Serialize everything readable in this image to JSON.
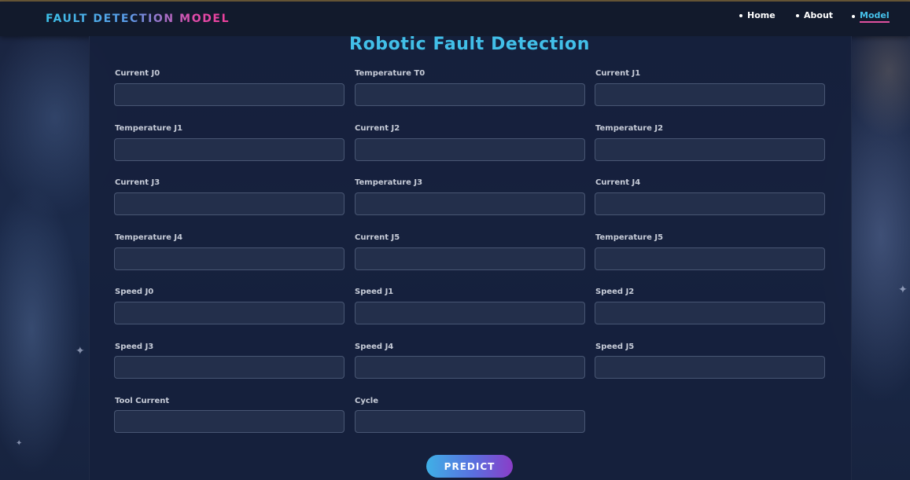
{
  "navbar": {
    "brand": "FAULT DETECTION MODEL",
    "links": [
      {
        "label": "Home",
        "active": false
      },
      {
        "label": "About",
        "active": false
      },
      {
        "label": "Model",
        "active": true
      }
    ]
  },
  "page_title": "Robotic Fault Detection",
  "form": {
    "fields": [
      {
        "label": "Current J0",
        "value": ""
      },
      {
        "label": "Temperature T0",
        "value": ""
      },
      {
        "label": "Current J1",
        "value": ""
      },
      {
        "label": "Temperature J1",
        "value": ""
      },
      {
        "label": "Current J2",
        "value": ""
      },
      {
        "label": "Temperature J2",
        "value": ""
      },
      {
        "label": "Current J3",
        "value": ""
      },
      {
        "label": "Temperature J3",
        "value": ""
      },
      {
        "label": "Current J4",
        "value": ""
      },
      {
        "label": "Temperature J4",
        "value": ""
      },
      {
        "label": "Current J5",
        "value": ""
      },
      {
        "label": "Temperature J5",
        "value": ""
      },
      {
        "label": "Speed J0",
        "value": ""
      },
      {
        "label": "Speed J1",
        "value": ""
      },
      {
        "label": "Speed J2",
        "value": ""
      },
      {
        "label": "Speed J3",
        "value": ""
      },
      {
        "label": "Speed J4",
        "value": ""
      },
      {
        "label": "Speed J5",
        "value": ""
      },
      {
        "label": "Tool Current",
        "value": ""
      },
      {
        "label": "Cycle",
        "value": ""
      }
    ],
    "submit_label": "PREDICT"
  },
  "colors": {
    "accent": "#42bfe8",
    "brand_pink": "#e04cab",
    "background": "#16213a"
  }
}
